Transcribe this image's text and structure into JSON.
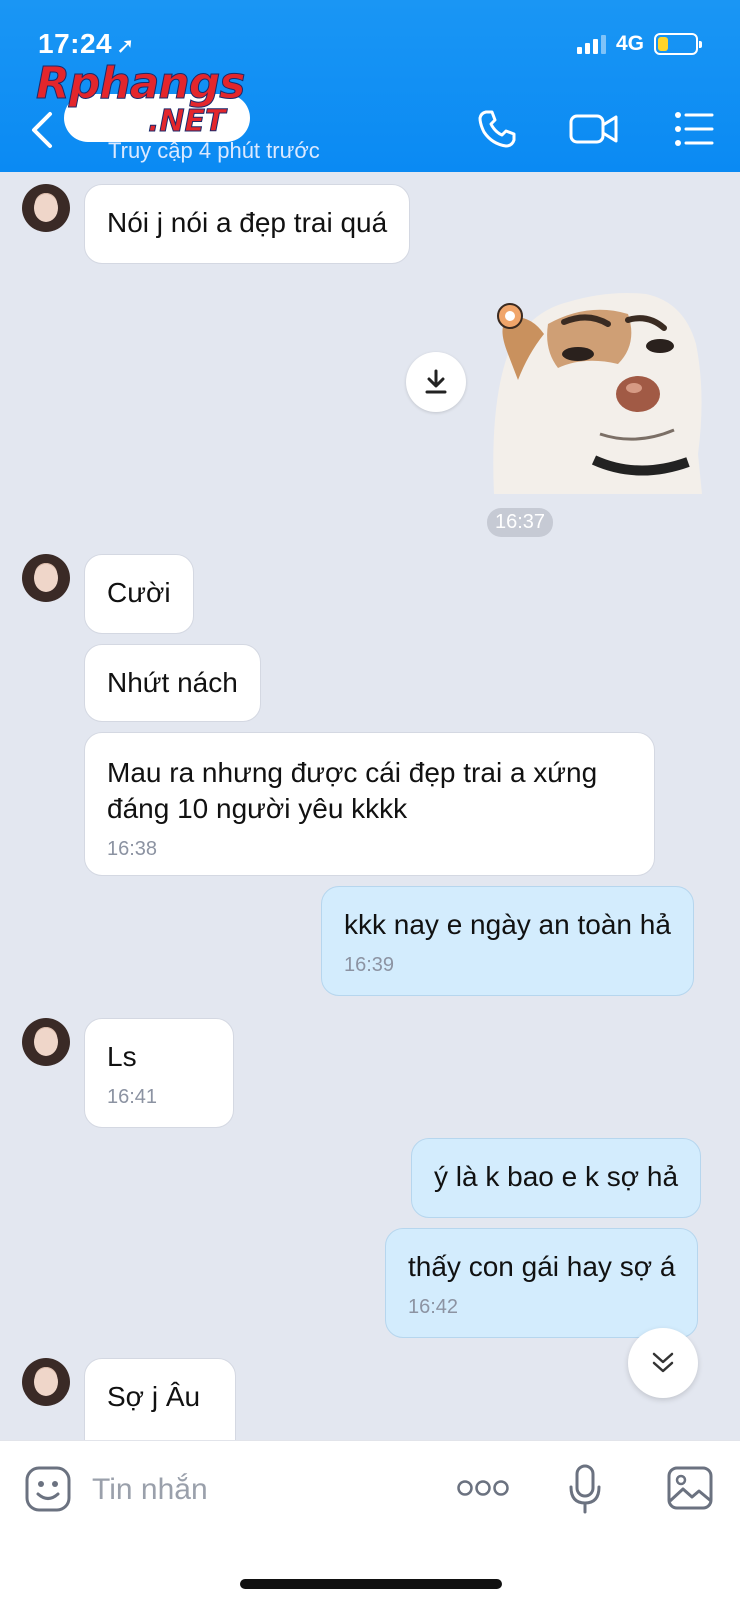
{
  "status_bar": {
    "time": "17:24",
    "network": "4G"
  },
  "watermark": {
    "top": "Rphangs",
    "bottom": ".NET"
  },
  "header": {
    "last_seen": "Truy cập 4 phút trước"
  },
  "messages": [
    {
      "side": "left",
      "text": "Nói j nói a đẹp trai quá"
    },
    {
      "side": "right",
      "type": "sticker",
      "time": "16:37"
    },
    {
      "side": "left",
      "text": "Cười"
    },
    {
      "side": "left",
      "text": "Nhứt nách"
    },
    {
      "side": "left",
      "text": "Mau ra nhưng được cái đẹp trai a xứng đáng 10 người yêu kkkk",
      "time": "16:38"
    },
    {
      "side": "right",
      "text": "kkk nay e ngày an toàn hả",
      "time": "16:39"
    },
    {
      "side": "left",
      "text": "Ls",
      "time": "16:41"
    },
    {
      "side": "right",
      "text": "ý là k bao e k sợ hả"
    },
    {
      "side": "right",
      "text": "thấy con gái hay sợ á",
      "time": "16:42"
    },
    {
      "side": "left",
      "text": "Sợ j Âu"
    }
  ],
  "composer": {
    "placeholder": "Tin nhắn"
  },
  "icons": {
    "back": "chevron-left-icon",
    "call": "phone-icon",
    "video": "video-camera-icon",
    "menu": "list-menu-icon",
    "download": "download-icon",
    "scroll": "double-chevron-down-icon",
    "sticker": "emoji-face-icon",
    "more": "more-dots-icon",
    "mic": "microphone-icon",
    "image": "image-icon"
  },
  "colors": {
    "header": "#0a8af3",
    "own_bubble": "#d3ecfd",
    "chat_bg": "#e3e7f0",
    "battery": "#ffd42a"
  }
}
